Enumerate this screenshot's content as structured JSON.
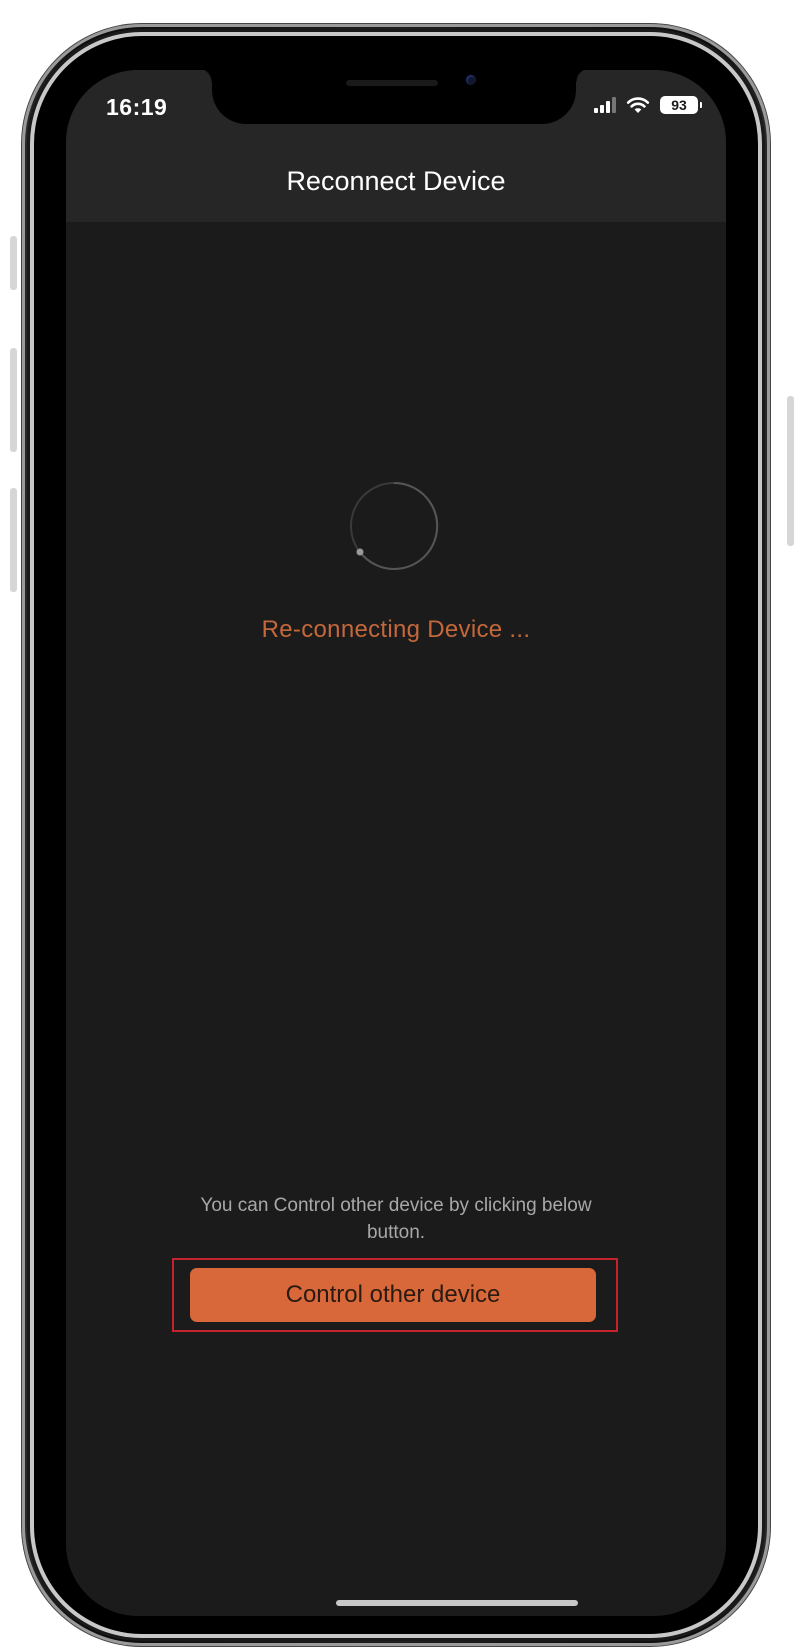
{
  "status_bar": {
    "time": "16:19",
    "battery": "93",
    "icons": [
      "signal-icon",
      "wifi-icon",
      "battery-icon"
    ]
  },
  "nav": {
    "title": "Reconnect Device"
  },
  "main": {
    "status_text": "Re-connecting Device ...",
    "hint": "You can Control other device by clicking below button.",
    "button_label": "Control other device"
  },
  "colors": {
    "background": "#1b1b1b",
    "header": "#262626",
    "accent": "#d8683a",
    "status_text": "#c4683b",
    "highlight_border": "#c4232e"
  }
}
